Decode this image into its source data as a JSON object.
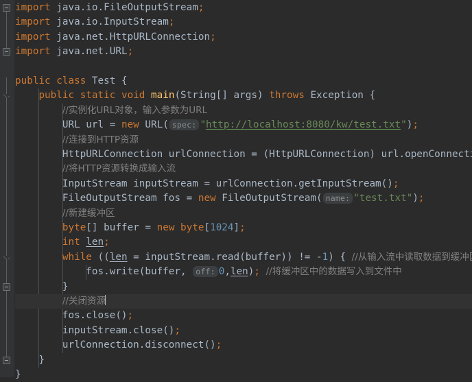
{
  "app": {
    "name": "intellij-idea-java-editor",
    "theme": "darcula",
    "language": "Java"
  },
  "colors": {
    "background": "#2b2b2b",
    "gutter": "#313335",
    "default_text": "#a9b7c6",
    "keyword": "#cc7832",
    "comment": "#808080",
    "number": "#6897bb",
    "string": "#6a8759",
    "method_name": "#ffc66d",
    "inlay_hint_bg": "#3c3f41",
    "inlay_hint_text": "#8c8c8c",
    "current_line": "#323232",
    "indent_guide": "#4b5052",
    "fold_line": "#5e6060"
  },
  "editor": {
    "caret_line_index": 16,
    "lines": [
      {
        "index": 0,
        "indent": 0,
        "tokens": [
          {
            "t": "import",
            "c": "kw"
          },
          {
            "t": " java.io.FileOutputStream",
            "c": "ident"
          },
          {
            "t": ";",
            "c": "semi"
          }
        ]
      },
      {
        "index": 1,
        "indent": 0,
        "tokens": [
          {
            "t": "import",
            "c": "kw"
          },
          {
            "t": " java.io.InputStream",
            "c": "ident"
          },
          {
            "t": ";",
            "c": "semi"
          }
        ]
      },
      {
        "index": 2,
        "indent": 0,
        "tokens": [
          {
            "t": "import",
            "c": "kw"
          },
          {
            "t": " java.net.HttpURLConnection",
            "c": "ident"
          },
          {
            "t": ";",
            "c": "semi"
          }
        ]
      },
      {
        "index": 3,
        "indent": 0,
        "tokens": [
          {
            "t": "import",
            "c": "kw"
          },
          {
            "t": " java.net.URL",
            "c": "ident"
          },
          {
            "t": ";",
            "c": "semi"
          }
        ]
      },
      {
        "index": 4,
        "indent": 0,
        "tokens": []
      },
      {
        "index": 5,
        "indent": 0,
        "tokens": [
          {
            "t": "public",
            "c": "kw"
          },
          {
            "t": " ",
            "c": "ident"
          },
          {
            "t": "class",
            "c": "kw"
          },
          {
            "t": " Test {",
            "c": "ident"
          }
        ]
      },
      {
        "index": 6,
        "indent": 1,
        "tokens": [
          {
            "t": "    ",
            "c": "ident"
          },
          {
            "t": "public",
            "c": "kw"
          },
          {
            "t": " ",
            "c": "ident"
          },
          {
            "t": "static",
            "c": "kw"
          },
          {
            "t": " ",
            "c": "ident"
          },
          {
            "t": "void",
            "c": "kw"
          },
          {
            "t": " ",
            "c": "ident"
          },
          {
            "t": "main",
            "c": "mname"
          },
          {
            "t": "(String[] args) ",
            "c": "ident"
          },
          {
            "t": "throws",
            "c": "kw"
          },
          {
            "t": " Exception {",
            "c": "ident"
          }
        ]
      },
      {
        "index": 7,
        "indent": 2,
        "tokens": [
          {
            "t": "        ",
            "c": "ident"
          },
          {
            "t": "//实例化URL对象，输入参数为URL",
            "c": "cmt cjk"
          }
        ]
      },
      {
        "index": 8,
        "indent": 2,
        "tokens": [
          {
            "t": "        URL url = ",
            "c": "ident"
          },
          {
            "t": "new",
            "c": "kw"
          },
          {
            "t": " URL(",
            "c": "ident"
          },
          {
            "t": "spec:",
            "c": "hint"
          },
          {
            "t": "\"",
            "c": "str"
          },
          {
            "t": "http://localhost:8080/kw/test.txt",
            "c": "link"
          },
          {
            "t": "\"",
            "c": "str"
          },
          {
            "t": ")",
            "c": "ident"
          },
          {
            "t": ";",
            "c": "semi"
          }
        ]
      },
      {
        "index": 9,
        "indent": 2,
        "tokens": [
          {
            "t": "        ",
            "c": "ident"
          },
          {
            "t": "//连接到HTTP资源",
            "c": "cmt cjk"
          }
        ]
      },
      {
        "index": 10,
        "indent": 2,
        "tokens": [
          {
            "t": "        HttpURLConnection urlConnection = (HttpURLConnection) url.openConnection()",
            "c": "ident"
          },
          {
            "t": ";",
            "c": "semi"
          }
        ]
      },
      {
        "index": 11,
        "indent": 2,
        "tokens": [
          {
            "t": "        ",
            "c": "ident"
          },
          {
            "t": "//将HTTP资源转换成输入流",
            "c": "cmt cjk"
          }
        ]
      },
      {
        "index": 12,
        "indent": 2,
        "tokens": [
          {
            "t": "        InputStream inputStream = urlConnection.getInputStream()",
            "c": "ident"
          },
          {
            "t": ";",
            "c": "semi"
          }
        ]
      },
      {
        "index": 13,
        "indent": 2,
        "tokens": [
          {
            "t": "        FileOutputStream fos = ",
            "c": "ident"
          },
          {
            "t": "new",
            "c": "kw"
          },
          {
            "t": " FileOutputStream(",
            "c": "ident"
          },
          {
            "t": "name:",
            "c": "hint"
          },
          {
            "t": "\"test.txt\"",
            "c": "str"
          },
          {
            "t": ")",
            "c": "ident"
          },
          {
            "t": ";",
            "c": "semi"
          }
        ]
      },
      {
        "index": 14,
        "indent": 2,
        "tokens": [
          {
            "t": "        ",
            "c": "ident"
          },
          {
            "t": "//新建缓冲区",
            "c": "cmt cjk"
          }
        ]
      },
      {
        "index": 15,
        "indent": 2,
        "tokens": [
          {
            "t": "        ",
            "c": "ident"
          },
          {
            "t": "byte",
            "c": "kw"
          },
          {
            "t": "[] buffer = ",
            "c": "ident"
          },
          {
            "t": "new",
            "c": "kw"
          },
          {
            "t": " ",
            "c": "ident"
          },
          {
            "t": "byte",
            "c": "kw"
          },
          {
            "t": "[",
            "c": "ident"
          },
          {
            "t": "1024",
            "c": "num"
          },
          {
            "t": "]",
            "c": "ident"
          },
          {
            "t": ";",
            "c": "semi"
          }
        ]
      },
      {
        "index": 16,
        "indent": 2,
        "tokens": [
          {
            "t": "        ",
            "c": "ident"
          },
          {
            "t": "int",
            "c": "kw"
          },
          {
            "t": " ",
            "c": "ident"
          },
          {
            "t": "len",
            "c": "local-u"
          },
          {
            "t": ";",
            "c": "semi"
          }
        ]
      },
      {
        "index": 17,
        "indent": 2,
        "tokens": [
          {
            "t": "        ",
            "c": "ident"
          },
          {
            "t": "while",
            "c": "kw"
          },
          {
            "t": " ((",
            "c": "ident"
          },
          {
            "t": "len",
            "c": "local-u"
          },
          {
            "t": " = inputStream.read(buffer)) != -",
            "c": "ident"
          },
          {
            "t": "1",
            "c": "num"
          },
          {
            "t": ") { ",
            "c": "ident"
          },
          {
            "t": "//从输入流中读取数据到缓冲区中",
            "c": "cmt cjk"
          }
        ]
      },
      {
        "index": 18,
        "indent": 3,
        "tokens": [
          {
            "t": "            fos.write(buffer, ",
            "c": "ident"
          },
          {
            "t": "off:",
            "c": "hint"
          },
          {
            "t": "0",
            "c": "num"
          },
          {
            "t": ",",
            "c": "ident"
          },
          {
            "t": "len",
            "c": "local-u"
          },
          {
            "t": ")",
            "c": "ident"
          },
          {
            "t": "; ",
            "c": "semi"
          },
          {
            "t": "//将缓冲区中的数据写入到文件中",
            "c": "cmt cjk"
          }
        ]
      },
      {
        "index": 19,
        "indent": 2,
        "tokens": [
          {
            "t": "        }",
            "c": "ident"
          }
        ]
      },
      {
        "index": 20,
        "indent": 2,
        "current": true,
        "caret": true,
        "tokens": [
          {
            "t": "        ",
            "c": "ident"
          },
          {
            "t": "//关闭资源",
            "c": "cmt cjk"
          }
        ]
      },
      {
        "index": 21,
        "indent": 2,
        "tokens": [
          {
            "t": "        fos.close()",
            "c": "ident"
          },
          {
            "t": ";",
            "c": "semi"
          }
        ]
      },
      {
        "index": 22,
        "indent": 2,
        "tokens": [
          {
            "t": "        inputStream.close()",
            "c": "ident"
          },
          {
            "t": ";",
            "c": "semi"
          }
        ]
      },
      {
        "index": 23,
        "indent": 2,
        "tokens": [
          {
            "t": "        urlConnection.disconnect()",
            "c": "ident"
          },
          {
            "t": ";",
            "c": "semi"
          }
        ]
      },
      {
        "index": 24,
        "indent": 1,
        "tokens": [
          {
            "t": "    }",
            "c": "ident"
          }
        ]
      },
      {
        "index": 25,
        "indent": 0,
        "tokens": [
          {
            "t": "}",
            "c": "ident"
          }
        ]
      }
    ],
    "fold_markers": [
      {
        "name": "fold-imports-top",
        "type": "box",
        "line": 0
      },
      {
        "name": "fold-imports-end",
        "type": "box",
        "line": 3
      },
      {
        "name": "fold-method-main",
        "type": "arrow",
        "line": 6
      },
      {
        "name": "fold-while-start",
        "type": "arrow",
        "line": 17
      },
      {
        "name": "fold-while-end",
        "type": "box",
        "line": 19
      },
      {
        "name": "fold-class-end",
        "type": "box",
        "line": 24
      }
    ],
    "fold_spines": [
      {
        "name": "fold-spine-imports",
        "top_line": 0,
        "bottom_line": 3
      },
      {
        "name": "fold-spine-class",
        "top_line": 5,
        "bottom_line": 24
      },
      {
        "name": "fold-spine-method",
        "top_line": 6,
        "bottom_line": 24
      },
      {
        "name": "fold-spine-while",
        "top_line": 17,
        "bottom_line": 19
      }
    ],
    "indent_guides": [
      {
        "name": "indent-guide-level-1",
        "col": 4,
        "from_line": 6,
        "to_line": 24
      },
      {
        "name": "indent-guide-level-2",
        "col": 8,
        "from_line": 7,
        "to_line": 23
      },
      {
        "name": "indent-guide-level-3",
        "col": 12,
        "from_line": 18,
        "to_line": 18
      }
    ]
  }
}
